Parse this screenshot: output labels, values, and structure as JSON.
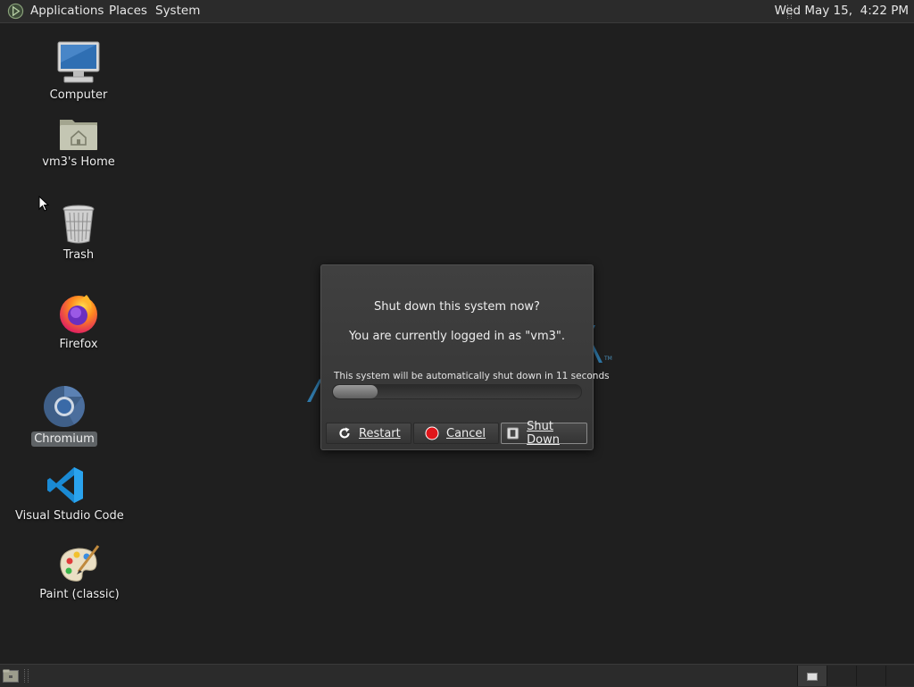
{
  "top_panel": {
    "menus": [
      "Applications",
      "Places",
      "System"
    ],
    "clock": "Wed May 15,  4:22 PM"
  },
  "desktop": {
    "icons": [
      {
        "label": "Computer",
        "icon": "computer-icon"
      },
      {
        "label": "vm3's Home",
        "icon": "home-folder-icon"
      },
      {
        "label": "Trash",
        "icon": "trash-icon"
      },
      {
        "label": "Firefox",
        "icon": "firefox-icon"
      },
      {
        "label": "Chromium",
        "icon": "chromium-icon",
        "selected": true
      },
      {
        "label": "Visual Studio Code",
        "icon": "vscode-icon"
      },
      {
        "label": "Paint (classic)",
        "icon": "paint-icon"
      }
    ]
  },
  "dialog": {
    "title": "Shut down this system now?",
    "subtitle": "You are currently logged in as \"vm3\".",
    "countdown": "This system will be automatically shut down in 11 seconds",
    "progress_fraction": 0.18,
    "buttons": {
      "restart": "Restart",
      "cancel": "Cancel",
      "shutdown": "Shut Down"
    }
  },
  "colors": {
    "desktop_bg": "#1f1f1f",
    "panel_bg": "#2b2b2b",
    "dialog_bg": "#3a3a3a",
    "cancel_red": "#e0161b",
    "logo_blue": "#4a8db6"
  }
}
